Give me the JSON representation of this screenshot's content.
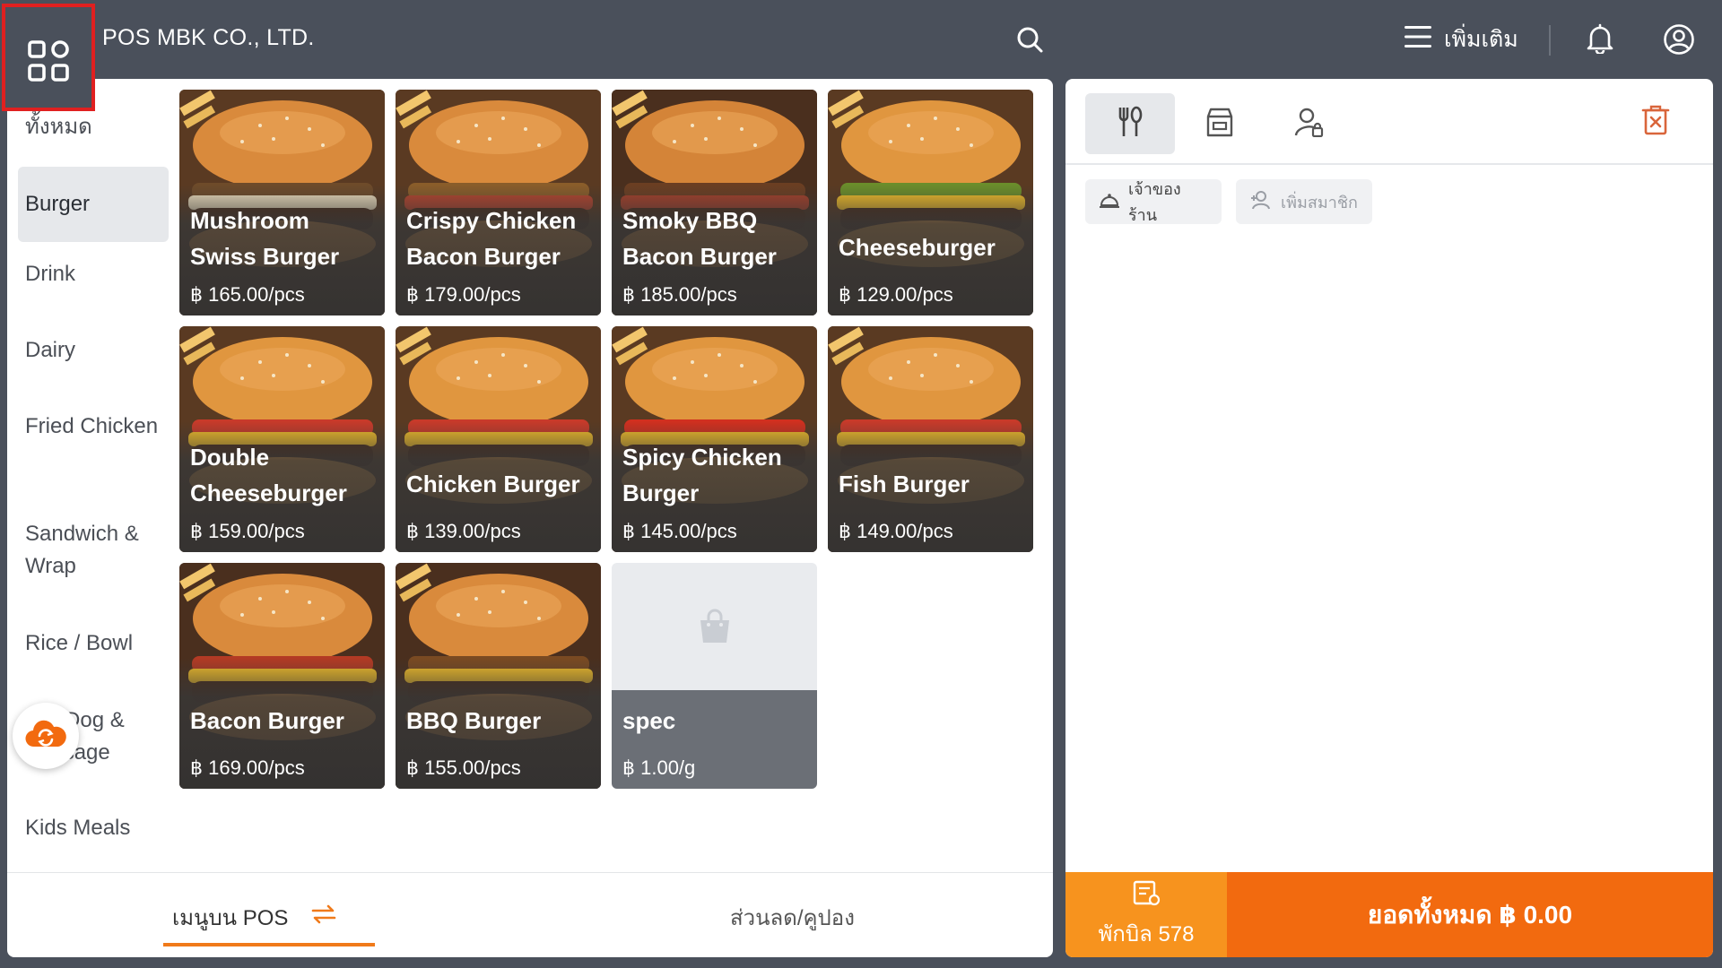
{
  "header": {
    "brand": "POS MBK CO., LTD.",
    "more_label": "เพิ่มเติม",
    "icons": [
      "apps-grid-icon",
      "search-icon",
      "menu-icon",
      "bell-icon",
      "user-circle-icon"
    ]
  },
  "categories": [
    {
      "label": "ทั้งหมด",
      "active": false
    },
    {
      "label": "Burger",
      "active": true
    },
    {
      "label": "Drink",
      "active": false
    },
    {
      "label": "Dairy",
      "active": false
    },
    {
      "label": "Fried Chicken",
      "active": false
    },
    {
      "label": "Sandwich & Wrap",
      "active": false
    },
    {
      "label": "Rice / Bowl",
      "active": false
    },
    {
      "label": "Hot Dog & Sausage",
      "active": false
    },
    {
      "label": "Kids Meals",
      "active": false
    }
  ],
  "products": [
    {
      "name": "Mushroom Swiss Burger",
      "price": "฿ 165.00/pcs"
    },
    {
      "name": "Crispy Chicken Bacon Burger",
      "price": "฿ 179.00/pcs"
    },
    {
      "name": "Smoky BBQ Bacon Burger",
      "price": "฿ 185.00/pcs"
    },
    {
      "name": "Cheeseburger",
      "price": "฿ 129.00/pcs"
    },
    {
      "name": "Double Cheeseburger",
      "price": "฿ 159.00/pcs"
    },
    {
      "name": "Chicken Burger",
      "price": "฿ 139.00/pcs"
    },
    {
      "name": "Spicy Chicken Burger",
      "price": "฿ 145.00/pcs"
    },
    {
      "name": "Fish Burger",
      "price": "฿ 149.00/pcs"
    },
    {
      "name": "Bacon Burger",
      "price": "฿ 169.00/pcs"
    },
    {
      "name": "BBQ Burger",
      "price": "฿ 155.00/pcs"
    },
    {
      "name": "spec",
      "price": "฿ 1.00/g"
    }
  ],
  "footer": {
    "tab_pos": "เมนูบน POS",
    "tab_discount": "ส่วนลด/คูปอง"
  },
  "order": {
    "mode_icons": [
      "dine-in-icon",
      "takeaway-bag-icon",
      "customer-icon"
    ],
    "chip_owner": "เจ้าของร้าน",
    "chip_member": "เพิ่มสมาชิก",
    "hold_label": "พักบิล 578",
    "total_label": "ยอดทั้งหมด ฿ 0.00"
  },
  "colors": {
    "accent": "#f26a0f",
    "hold": "#f7931e",
    "topbar": "#4a505b"
  }
}
